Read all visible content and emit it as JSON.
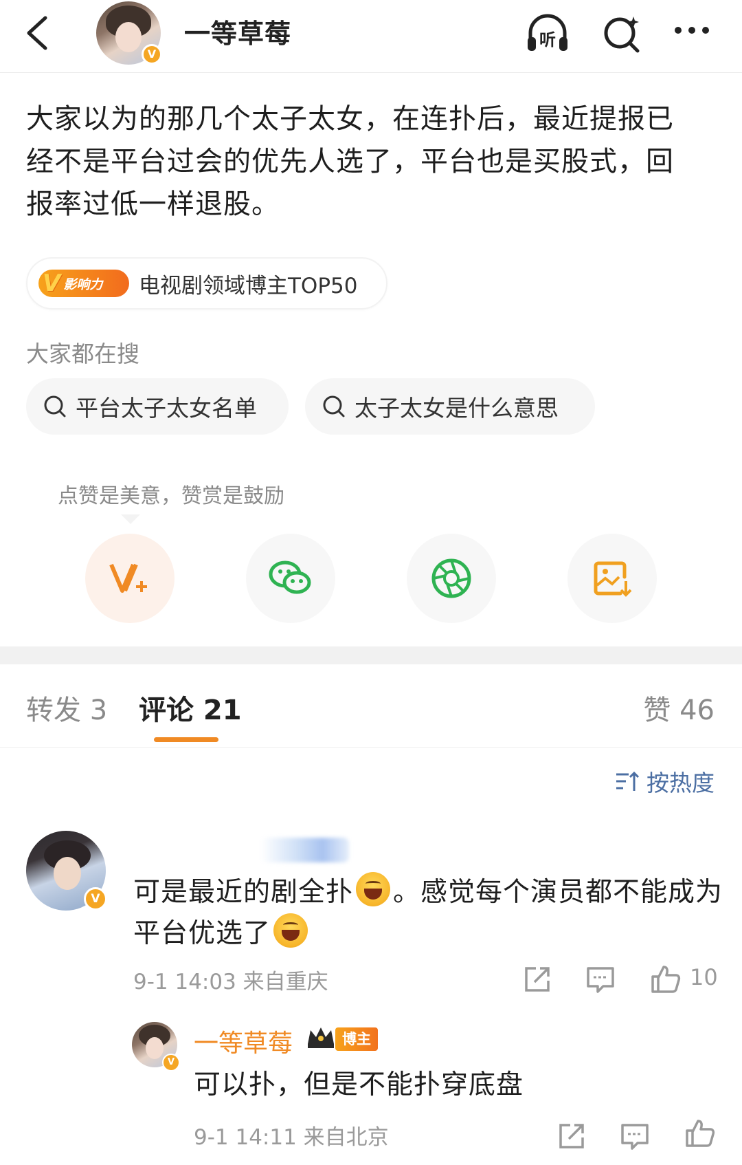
{
  "header": {
    "author_name": "一等草莓",
    "verified_mark": "V",
    "icons": [
      "back-icon",
      "listen-icon",
      "search-icon",
      "more-icon"
    ],
    "listen_glyph": "听"
  },
  "post": {
    "text": "大家以为的那几个太子太女，在连扑后，最近提报已经不是平台过会的优先人选了，平台也是买股式，回报率过低一样退股。",
    "influence_badge": "影响力",
    "influence_badge_mark": "V",
    "influence_label": "电视剧领域博主TOP50"
  },
  "search": {
    "title": "大家都在搜",
    "chips": [
      "平台太子太女名单",
      "太子太女是什么意思"
    ]
  },
  "reward": {
    "tip": "点赞是美意，赞赏是鼓励",
    "actions": [
      "reward-v-icon",
      "wechat-icon",
      "moments-icon",
      "save-image-icon"
    ]
  },
  "tabs": {
    "repost": "转发 3",
    "comment": "评论 21",
    "like": "赞 46"
  },
  "sort": {
    "label": "按热度"
  },
  "comments": [
    {
      "text_part1": "可是最近的剧全扑",
      "text_part2": "。感觉每个演员都不能成为平台优选了",
      "meta": "9-1 14:03 来自重庆",
      "likes": "10",
      "verified_mark": "V"
    }
  ],
  "reply": {
    "name": "一等草莓",
    "badge": "博主",
    "text": "可以扑，但是不能扑穿底盘",
    "meta": "9-1 14:11 来自北京",
    "verified_mark": "V"
  },
  "colors": {
    "accent_orange": "#f08a24",
    "link_blue": "#4c6fa3",
    "wechat_green": "#2fb352"
  }
}
